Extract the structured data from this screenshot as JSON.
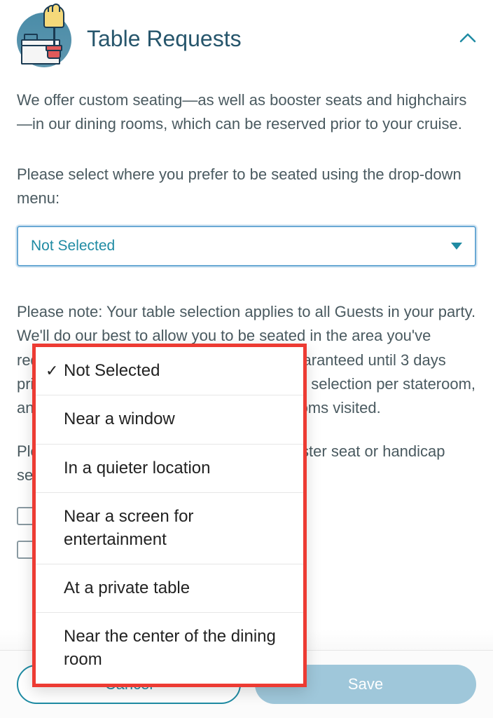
{
  "header": {
    "title": "Table Requests"
  },
  "intro": "We offer custom seating—as well as booster seats and highchairs—in our dining rooms, which can be reserved prior to your cruise.",
  "prompt": "Please select where you prefer to be seated using the drop-down menu:",
  "select": {
    "value": "Not Selected"
  },
  "notice": "Please note: Your table selection applies to all Guests in your party. We'll do our best to allow you to be seated in the area you've requested; however, seating cannot be guaranteed until 3 days prior to cruise departure. There is only one selection per stateroom, and your request will apply to all dining rooms visited.",
  "booster_prompt": "Please select if you need a highchair, booster seat or handicap seating:",
  "dropdown": {
    "selected_index": 0,
    "items": [
      "Not Selected",
      "Near a window",
      "In a quieter location",
      "Near a screen for entertainment",
      "At a private table",
      "Near the center of the dining room"
    ]
  },
  "buttons": {
    "cancel": "Cancel",
    "save": "Save"
  }
}
